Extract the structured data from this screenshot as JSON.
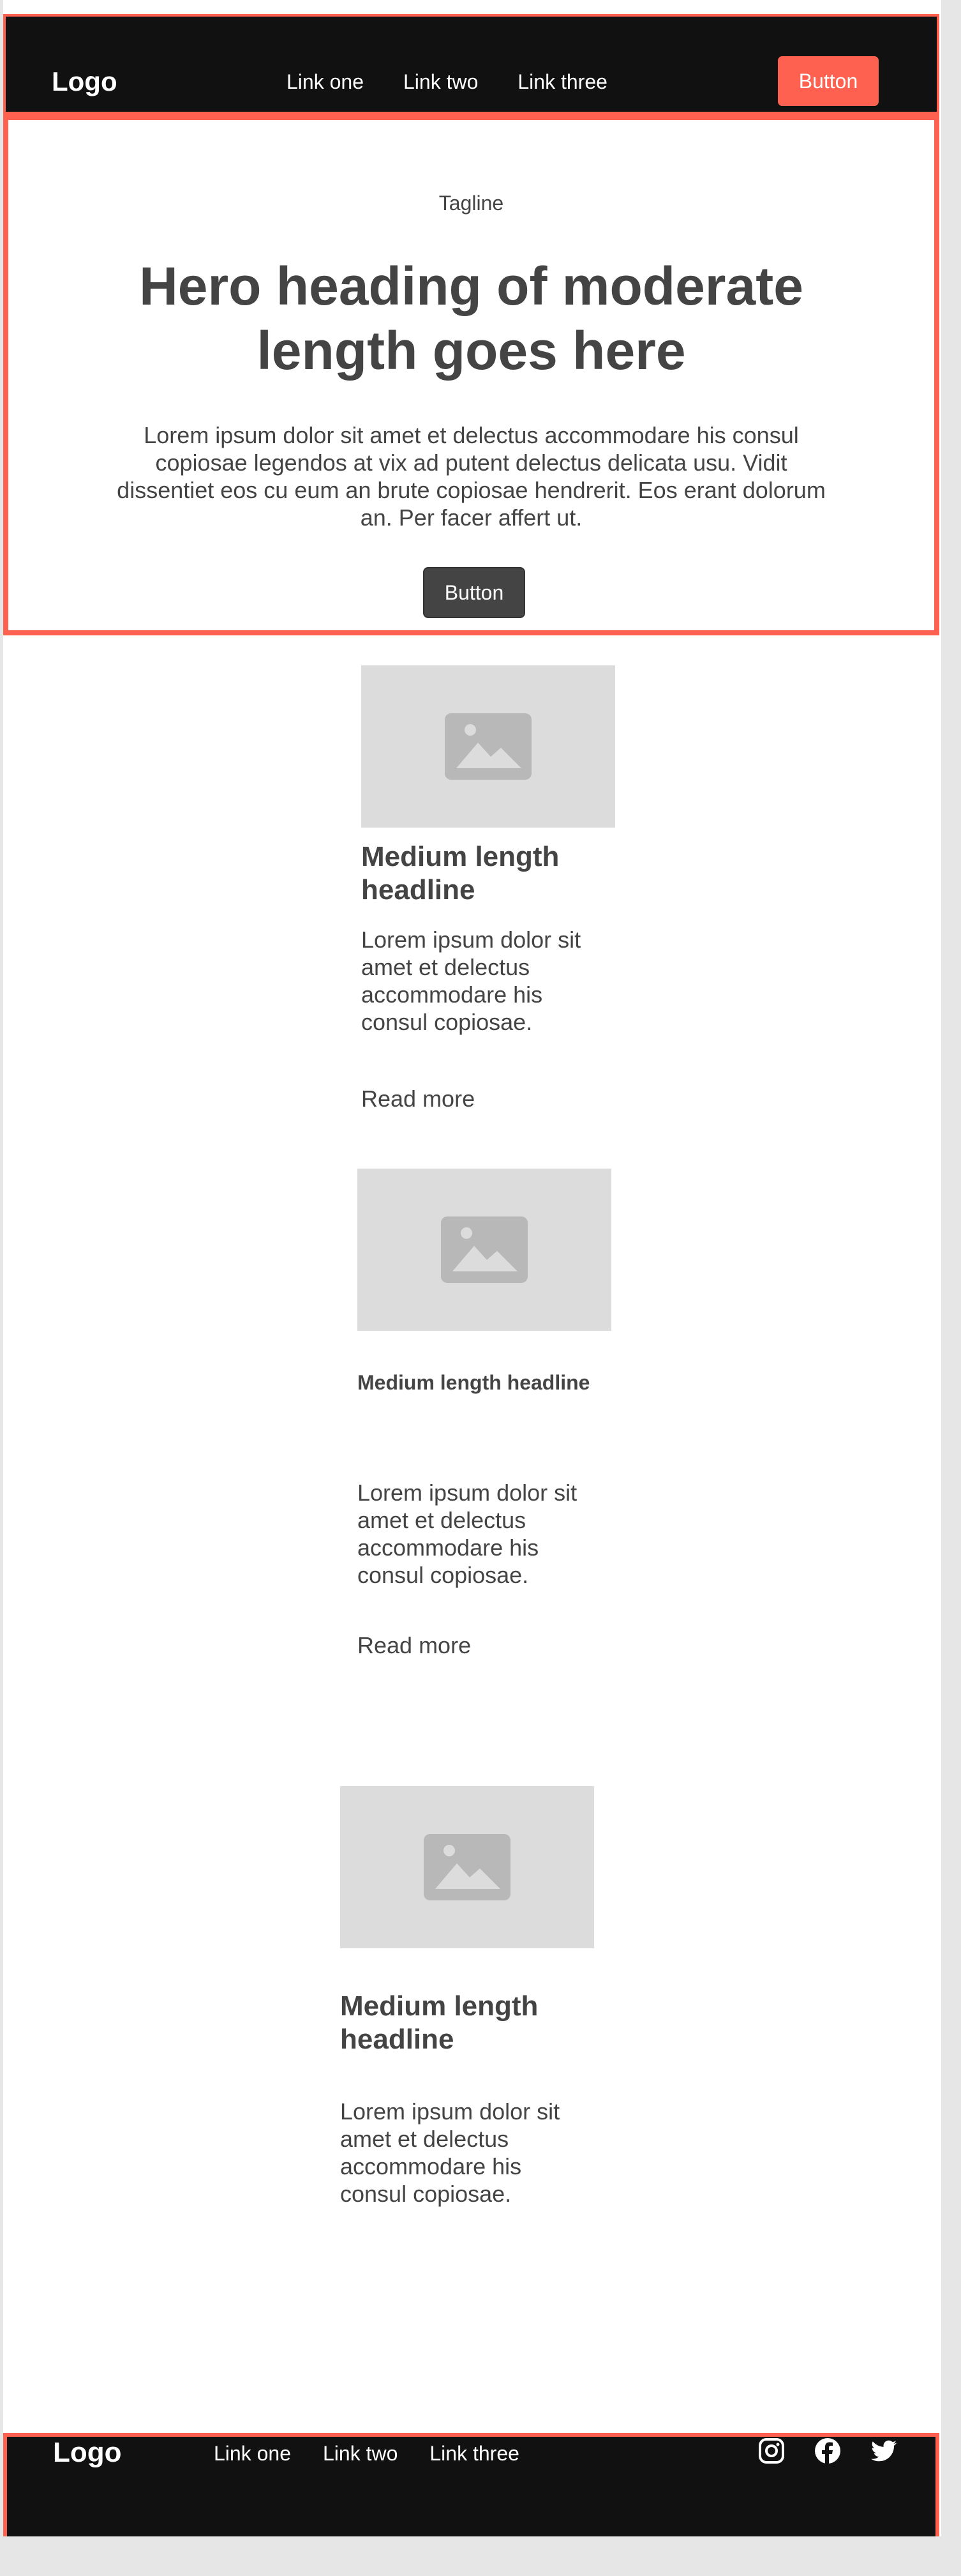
{
  "navbar": {
    "logo": "Logo",
    "links": [
      "Link one",
      "Link two",
      "Link three"
    ],
    "button": "Button"
  },
  "hero": {
    "tagline": "Tagline",
    "heading": "Hero heading of moderate length goes here",
    "body": "Lorem ipsum dolor sit amet et delectus accommodare his consul copiosae legendos at vix ad putent delectus delicata usu. Vidit dissentiet eos cu eum an brute copiosae hendrerit. Eos erant dolorum an. Per facer affert ut.",
    "button": "Button"
  },
  "cards": [
    {
      "icon": "image-placeholder-icon",
      "title": "Medium length headline",
      "body": "Lorem ipsum dolor sit amet et delectus accommodare his consul copiosae.",
      "link": "Read more"
    },
    {
      "icon": "image-placeholder-icon",
      "title": "Medium length headline",
      "body": "Lorem ipsum dolor sit amet et delectus accommodare his consul copiosae.",
      "link": "Read more"
    },
    {
      "icon": "image-placeholder-icon",
      "title": "Medium length headline",
      "body": "Lorem ipsum dolor sit amet et delectus accommodare his consul copiosae."
    }
  ],
  "footer": {
    "logo": "Logo",
    "links": [
      "Link one",
      "Link two",
      "Link three"
    ],
    "social": [
      "instagram-icon",
      "facebook-icon",
      "twitter-icon"
    ]
  },
  "colors": {
    "accent": "#ff6150",
    "dark": "#111111",
    "text": "#444444",
    "placeholder": "#dcdcdc"
  }
}
